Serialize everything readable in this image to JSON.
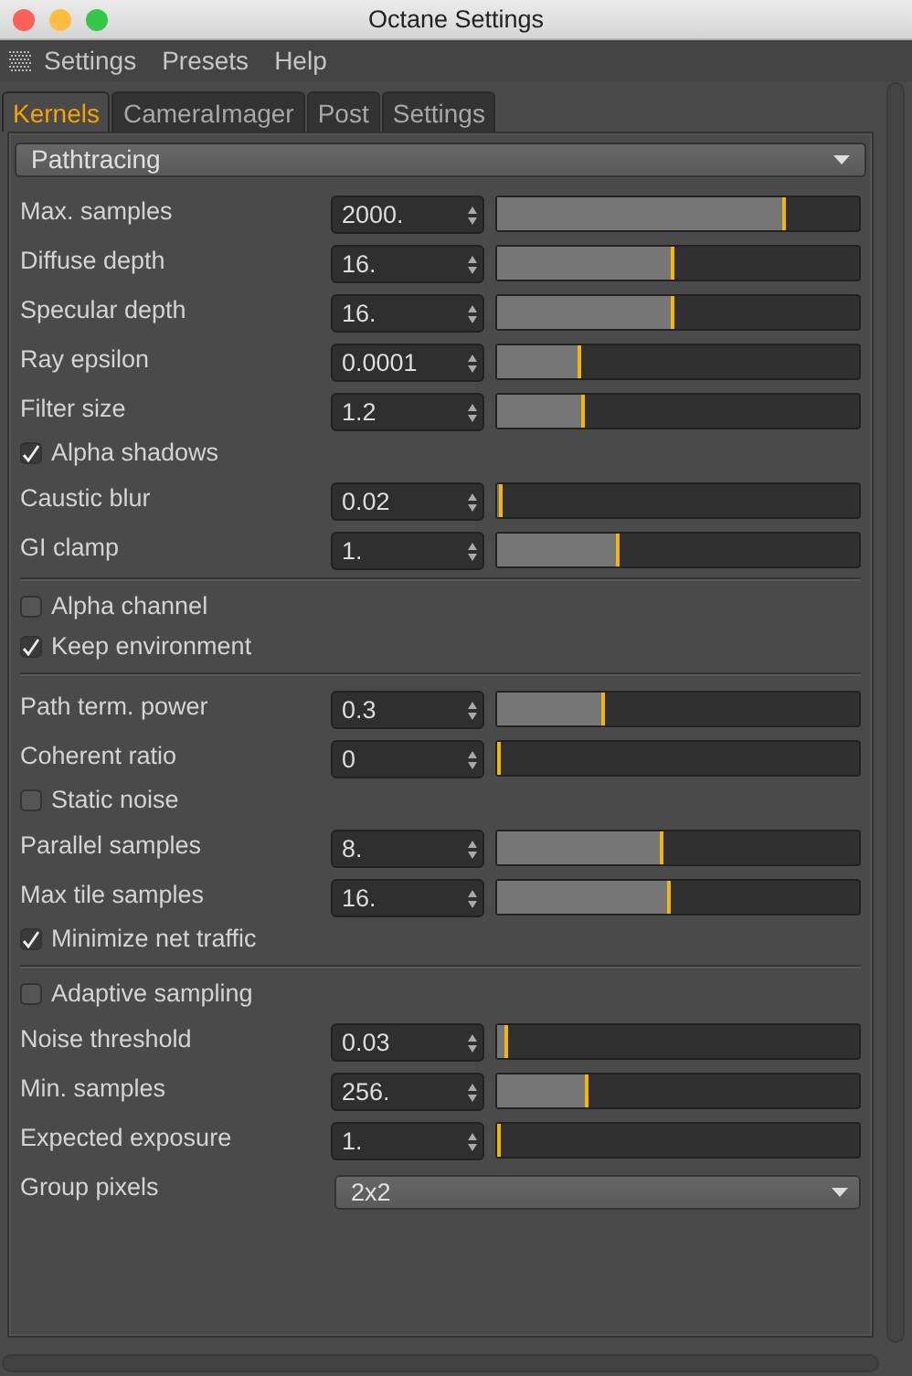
{
  "window": {
    "title": "Octane Settings"
  },
  "menu": [
    "Settings",
    "Presets",
    "Help"
  ],
  "tabs": [
    {
      "label": "Kernels",
      "selected": true
    },
    {
      "label": "CameraImager",
      "selected": false
    },
    {
      "label": "Post",
      "selected": false
    },
    {
      "label": "Settings",
      "selected": false
    }
  ],
  "kernel_dropdown": {
    "value": "Pathtracing"
  },
  "groups": [
    {
      "items": [
        {
          "kind": "param",
          "label": "Max. samples",
          "value": "2000.",
          "level": 0.8
        },
        {
          "kind": "param",
          "label": "Diffuse depth",
          "value": "16.",
          "level": 0.49
        },
        {
          "kind": "param",
          "label": "Specular depth",
          "value": "16.",
          "level": 0.49
        },
        {
          "kind": "param",
          "label": "Ray epsilon",
          "value": "0.0001",
          "level": 0.23
        },
        {
          "kind": "param",
          "label": "Filter size",
          "value": "1.2",
          "level": 0.24
        },
        {
          "kind": "check",
          "label": "Alpha shadows",
          "checked": true
        },
        {
          "kind": "param",
          "label": "Caustic blur",
          "value": "0.02",
          "level": 0.015
        },
        {
          "kind": "param",
          "label": "GI clamp",
          "value": "1.",
          "level": 0.34
        }
      ]
    },
    {
      "items": [
        {
          "kind": "check",
          "label": "Alpha channel",
          "checked": false
        },
        {
          "kind": "check",
          "label": "Keep environment",
          "checked": true
        }
      ]
    },
    {
      "items": [
        {
          "kind": "param",
          "label": "Path term. power",
          "value": "0.3",
          "level": 0.3
        },
        {
          "kind": "param",
          "label": "Coherent ratio",
          "value": "0",
          "level": 0
        },
        {
          "kind": "check",
          "label": "Static noise",
          "checked": false
        },
        {
          "kind": "param",
          "label": "Parallel samples",
          "value": "8.",
          "level": 0.46
        },
        {
          "kind": "param",
          "label": "Max tile samples",
          "value": "16.",
          "level": 0.48
        },
        {
          "kind": "check",
          "label": "Minimize net traffic",
          "checked": true
        }
      ]
    },
    {
      "items": [
        {
          "kind": "check",
          "label": "Adaptive sampling",
          "checked": false
        },
        {
          "kind": "param",
          "label": "Noise threshold",
          "value": "0.03",
          "level": 0.03
        },
        {
          "kind": "param",
          "label": "Min. samples",
          "value": "256.",
          "level": 0.25
        },
        {
          "kind": "param",
          "label": "Expected exposure",
          "value": "1.",
          "level": 0
        },
        {
          "kind": "select",
          "label": "Group pixels",
          "value": "2x2"
        }
      ]
    }
  ]
}
